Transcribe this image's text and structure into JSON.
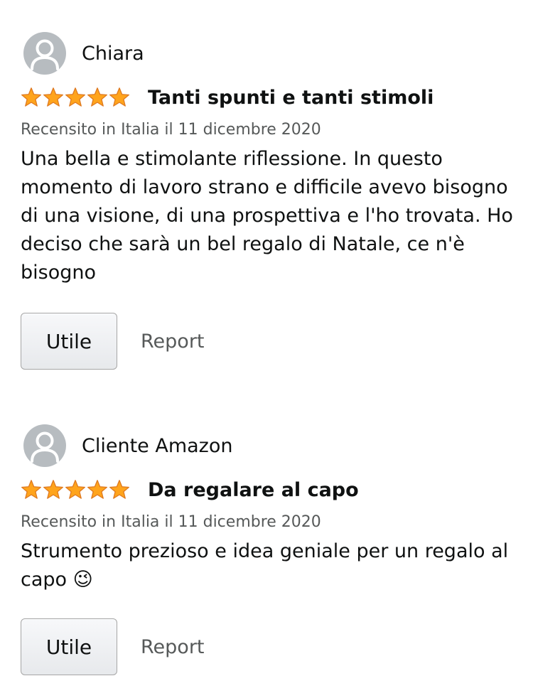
{
  "colors": {
    "text": "#0f1111",
    "secondary_text": "#565959",
    "star_fill": "#ffa41c",
    "star_stroke": "#de7921",
    "avatar_bg": "#b7bcc0"
  },
  "reviews": [
    {
      "author": "Chiara",
      "avatar_icon": "user-silhouette-icon",
      "rating": 5,
      "rating_max": 5,
      "title": "Tanti spunti e tanti stimoli",
      "date": "Recensito in Italia il 11 dicembre 2020",
      "body": "Una bella e stimolante riflessione. In questo momento di lavoro strano e difficile avevo bisogno di una visione, di una prospettiva e l'ho trovata. Ho deciso che sarà un bel regalo di Natale, ce n'è bisogno",
      "emoji": "",
      "helpful_label": "Utile",
      "report_label": "Report"
    },
    {
      "author": "Cliente Amazon",
      "avatar_icon": "user-silhouette-icon",
      "rating": 5,
      "rating_max": 5,
      "title": "Da regalare al capo",
      "date": "Recensito in Italia il 11 dicembre 2020",
      "body": "Strumento prezioso e idea geniale per un regalo al capo",
      "emoji": "😉",
      "helpful_label": "Utile",
      "report_label": "Report"
    }
  ]
}
